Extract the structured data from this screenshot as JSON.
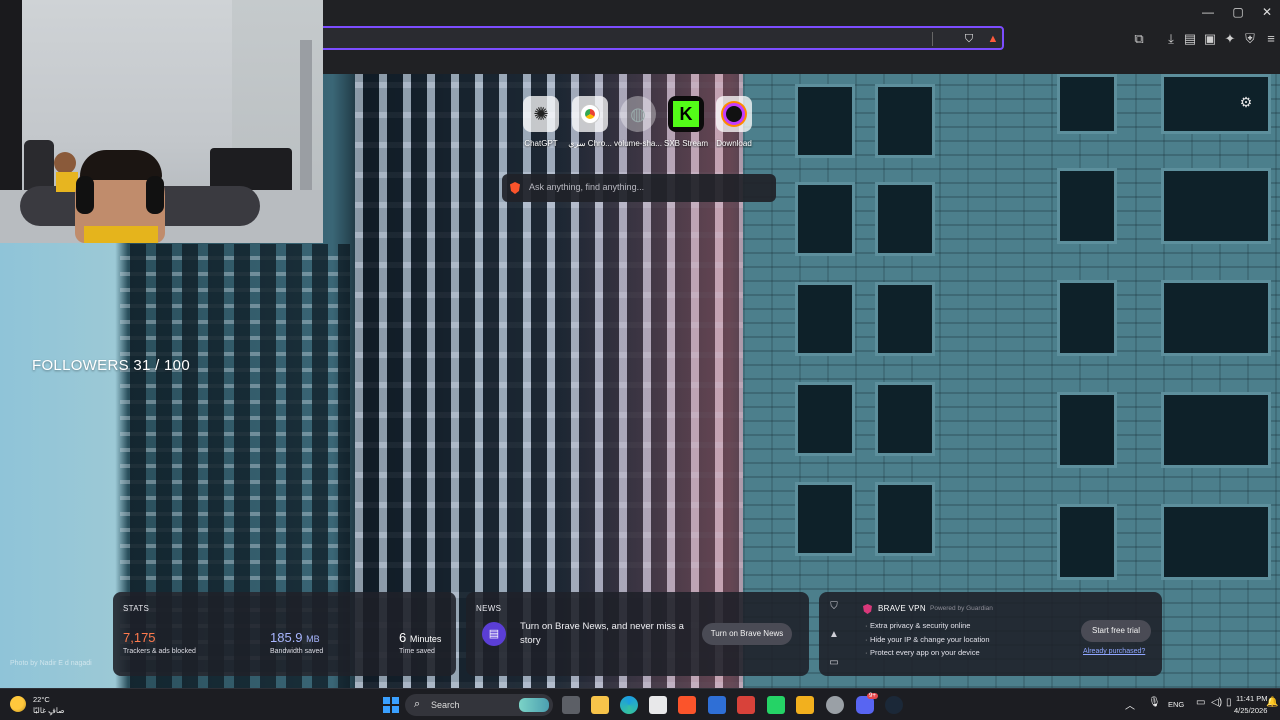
{
  "window": {
    "minimize": "—",
    "maximize": "▢",
    "close": "✕"
  },
  "toolbar": {
    "icons": [
      "shield-icon",
      "rewards-icon",
      "tabs-icon",
      "download-icon",
      "sidebar-icon",
      "wallet-icon",
      "leo-icon",
      "vpn-icon",
      "menu-icon"
    ]
  },
  "top_sites": [
    {
      "label": "ChatGPT",
      "icon": "chatgpt-icon"
    },
    {
      "label": "سري Chro...",
      "icon": "chrome-icon"
    },
    {
      "label": "volume-sha...",
      "icon": "globe-icon"
    },
    {
      "label": "SXB Stream",
      "icon": "kick-icon"
    },
    {
      "label": "Download",
      "icon": "aura-icon"
    }
  ],
  "search": {
    "placeholder": "Ask anything, find anything..."
  },
  "overlay": {
    "followers": "FOLLOWERS 31 / 100"
  },
  "photo_credit": "Photo by Nadir E d nagadi",
  "stats": {
    "title": "STATS",
    "trackers_value": "7,175",
    "trackers_caption": "Trackers & ads blocked",
    "bandwidth_value": "185.9",
    "bandwidth_unit": "MB",
    "bandwidth_caption": "Bandwidth saved",
    "time_value": "6",
    "time_unit": "Minutes",
    "time_caption": "Time saved"
  },
  "news": {
    "title": "NEWS",
    "text": "Turn on Brave News, and never miss a story",
    "button": "Turn on Brave News"
  },
  "vpn": {
    "title": "BRAVE VPN",
    "powered_by": "Powered by Guardian",
    "features": [
      "Extra privacy & security online",
      "Hide your IP & change your location",
      "Protect every app on your device"
    ],
    "button": "Start free trial",
    "link": "Already purchased?"
  },
  "taskbar": {
    "weather_temp": "22°C",
    "weather_desc": "صافٍ غالبًا",
    "search_label": "Search",
    "language": "ENG",
    "time": "11:41 PM",
    "date": "4/25/2026",
    "notification_badge": "9+"
  },
  "colors": {
    "accent": "#7c4dff",
    "trackers": "#ff7a4d",
    "bandwidth": "#a8b6ff",
    "brave": "#fb542b"
  }
}
